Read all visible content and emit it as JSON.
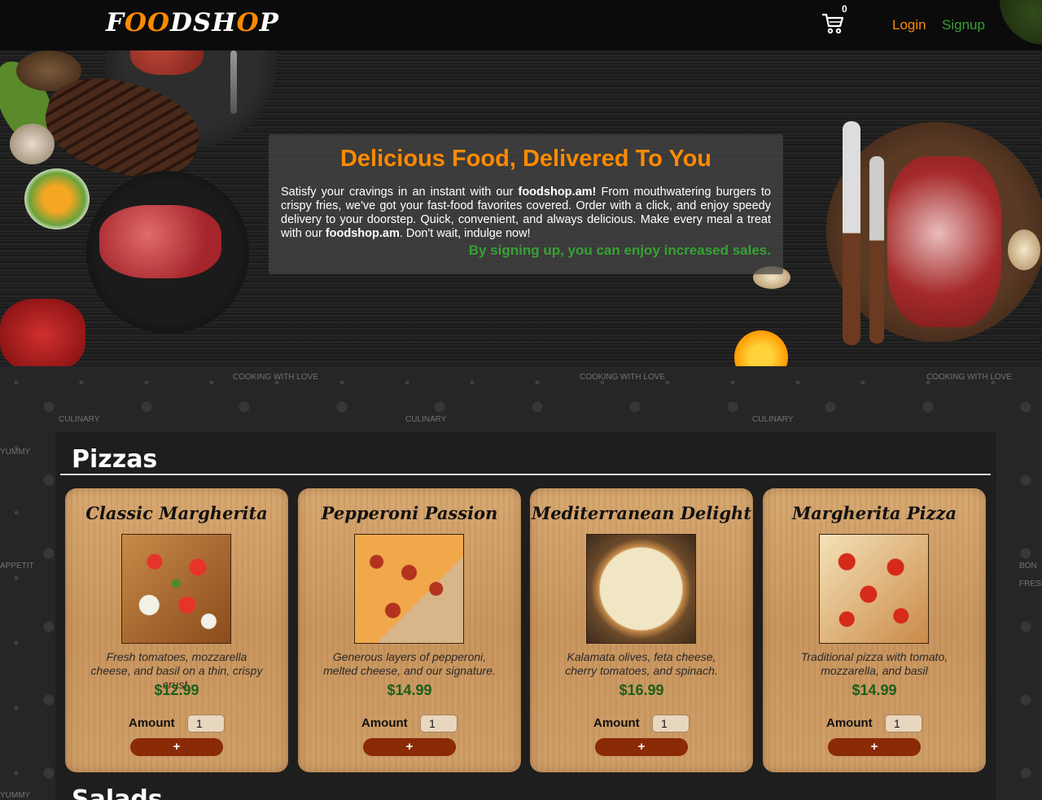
{
  "header": {
    "logo_prefix": "F",
    "logo_oo": "OO",
    "logo_mid": "DSH",
    "logo_o2": "O",
    "logo_suffix": "P",
    "cart_icon": "shopping-cart-icon",
    "cart_count": "0",
    "login_label": "Login",
    "signup_label": "Signup"
  },
  "hero": {
    "title": "Delicious Food, Delivered To You",
    "text_1": "Satisfy your cravings in an instant with our ",
    "brand_1": "foodshop.am!",
    "text_2": " From mouthwatering burgers to crispy fries, we've got your fast-food favorites covered. Order with a click, and enjoy speedy delivery to your doorstep. Quick, convenient, and always delicious. Make every meal a treat with our ",
    "brand_2": "foodshop.am",
    "text_3": ". Don't wait, indulge now!",
    "subtext": "By signing up, you can enjoy increased sales."
  },
  "doodles": [
    "COOKING WITH LOVE",
    "CULINARY",
    "COOKING WITH LOVE",
    "CULINARY",
    "COOKING WITH LOVE",
    "CULINARY",
    "YUMMY",
    "APPETIT",
    "BON",
    "FRESH",
    "YUMMY"
  ],
  "section": {
    "title": "Pizzas",
    "next_title": "Salads"
  },
  "products": [
    {
      "name": "Classic Margherita",
      "description": "Fresh tomatoes, mozzarella cheese, and basil on a thin, crispy crust.",
      "price": "$12.99",
      "amount_label": "Amount",
      "amount": "1",
      "add_label": "+"
    },
    {
      "name": "Pepperoni Passion",
      "description": "Generous layers of pepperoni, melted cheese, and our signature.",
      "price": "$14.99",
      "amount_label": "Amount",
      "amount": "1",
      "add_label": "+"
    },
    {
      "name": "Mediterranean Delight",
      "description": "Kalamata olives, feta cheese, cherry tomatoes, and spinach.",
      "price": "$16.99",
      "amount_label": "Amount",
      "amount": "1",
      "add_label": "+"
    },
    {
      "name": "Margherita Pizza",
      "description": "Traditional pizza with tomato, mozzarella, and basil",
      "price": "$14.99",
      "amount_label": "Amount",
      "amount": "1",
      "add_label": "+"
    }
  ],
  "colors": {
    "accent": "#ff8a00",
    "green": "#37a233",
    "price_green": "#1b5e1b",
    "button": "#8a2a06"
  }
}
